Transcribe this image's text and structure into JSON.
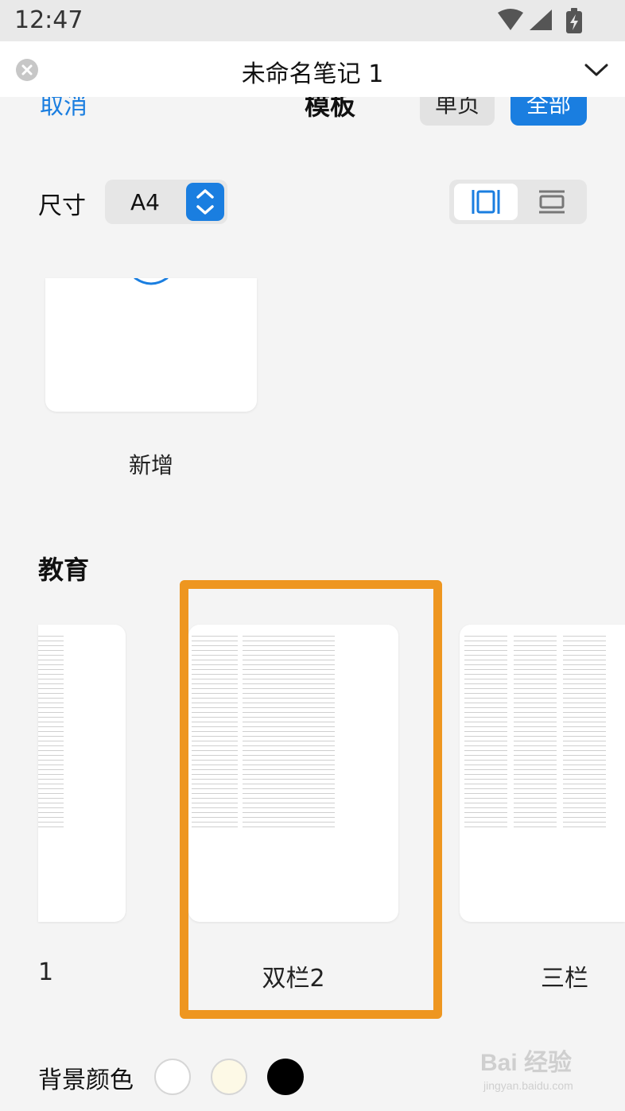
{
  "status_bar": {
    "time": "12:47",
    "icons": [
      "wifi-icon",
      "signal-icon",
      "battery-charging-icon"
    ]
  },
  "title_bar": {
    "title": "未命名笔记 1",
    "icons": [
      "close-icon",
      "chevron-down-icon"
    ]
  },
  "header": {
    "cancel_label": "取消",
    "title": "模板",
    "single_label": "单页",
    "all_label": "全部"
  },
  "size": {
    "label": "尺寸",
    "value": "A4"
  },
  "orientation": {
    "selected": "portrait",
    "options": [
      "portrait",
      "landscape"
    ]
  },
  "add_template": {
    "label": "新增"
  },
  "section": {
    "title": "教育"
  },
  "templates": [
    {
      "label": "1",
      "columns": 1
    },
    {
      "label": "双栏2",
      "columns": 2,
      "selected": true
    },
    {
      "label": "三栏",
      "columns": 3
    }
  ],
  "background": {
    "label": "背景颜色",
    "colors": [
      "#ffffff",
      "#fdf9e6",
      "#000000"
    ]
  },
  "accent_color": "#1a7ee0",
  "highlight_color": "#ee9620",
  "watermark": {
    "text": "Bai 经验",
    "sub": "jingyan.baidu.com"
  }
}
